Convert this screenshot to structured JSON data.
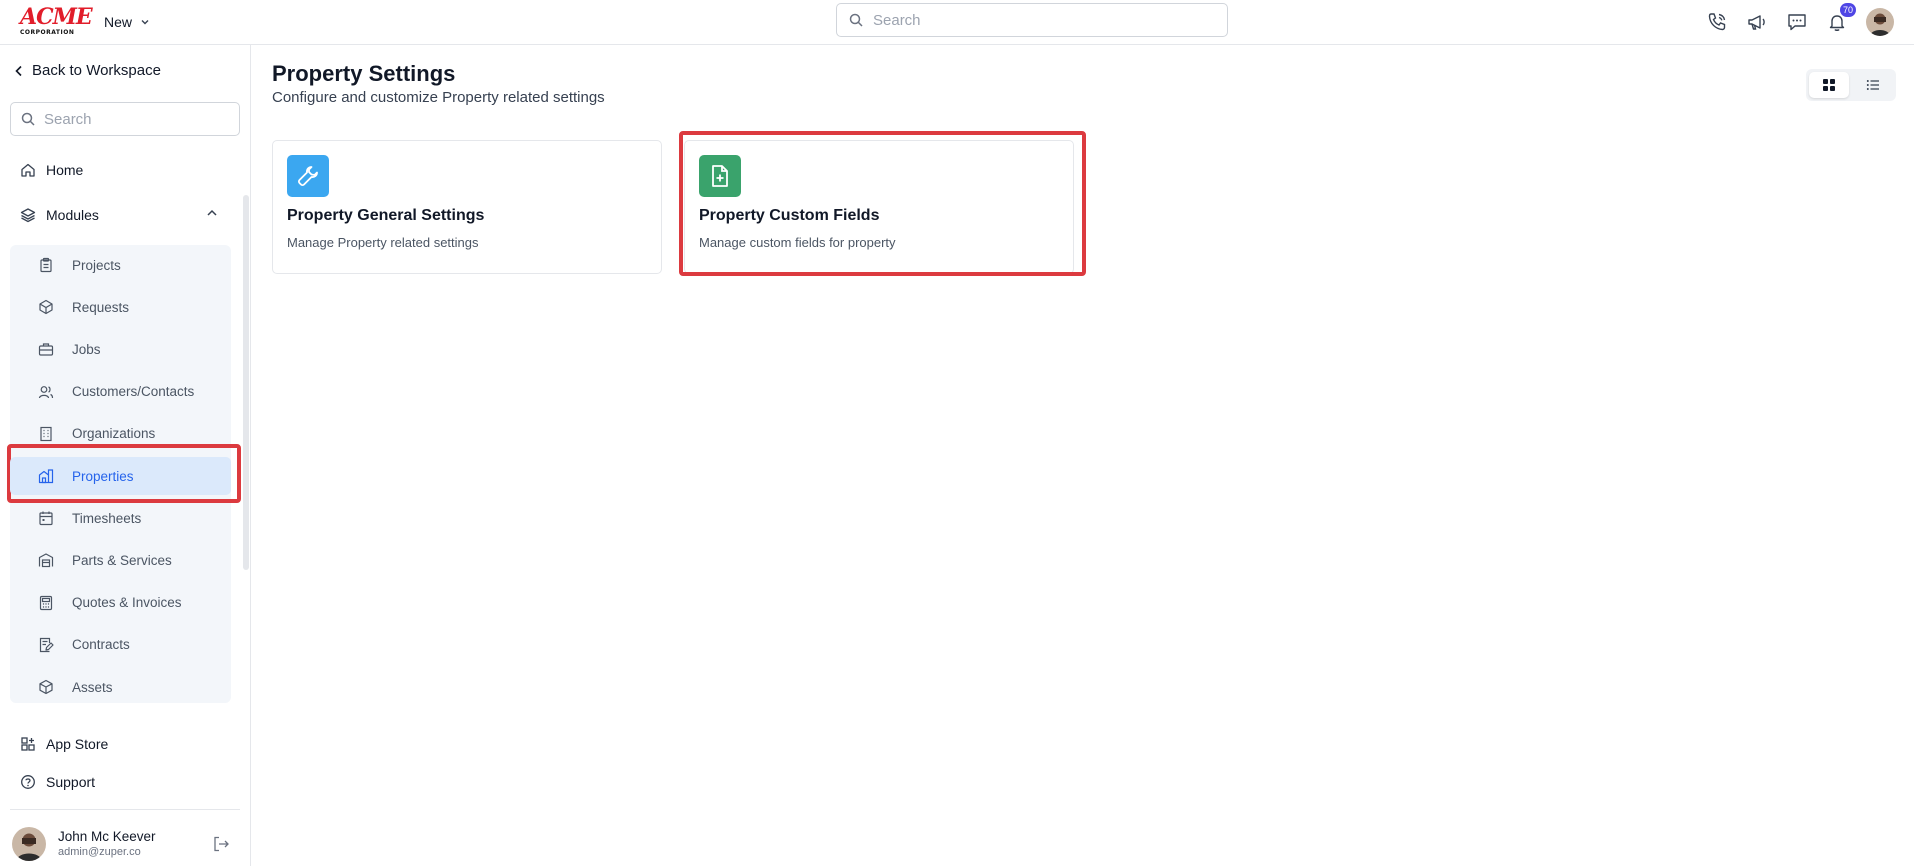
{
  "brand": {
    "logo_main": "ACME",
    "logo_sub": "CORPORATION",
    "accent": "#e11d2a"
  },
  "topbar": {
    "new_label": "New",
    "search_placeholder": "Search",
    "notification_count": "70",
    "icons": [
      "phone-icon",
      "megaphone-icon",
      "chat-icon",
      "bell-icon"
    ]
  },
  "sidebar": {
    "back_label": "Back to Workspace",
    "search_placeholder": "Search",
    "home_label": "Home",
    "modules_label": "Modules",
    "modules": [
      {
        "label": "Projects",
        "icon": "clipboard-icon"
      },
      {
        "label": "Requests",
        "icon": "box-icon"
      },
      {
        "label": "Jobs",
        "icon": "briefcase-icon"
      },
      {
        "label": "Customers/Contacts",
        "icon": "users-icon"
      },
      {
        "label": "Organizations",
        "icon": "building-icon"
      },
      {
        "label": "Properties",
        "icon": "property-icon",
        "active": true
      },
      {
        "label": "Timesheets",
        "icon": "calendar-icon"
      },
      {
        "label": "Parts & Services",
        "icon": "warehouse-icon"
      },
      {
        "label": "Quotes & Invoices",
        "icon": "calculator-icon"
      },
      {
        "label": "Contracts",
        "icon": "contract-icon"
      },
      {
        "label": "Assets",
        "icon": "cube-icon"
      }
    ],
    "app_store_label": "App Store",
    "support_label": "Support",
    "user": {
      "name": "John Mc Keever",
      "email": "admin@zuper.co"
    }
  },
  "main": {
    "title": "Property Settings",
    "subtitle": "Configure and customize Property related settings",
    "cards": [
      {
        "title": "Property General Settings",
        "description": "Manage Property related settings",
        "icon": "wrench-icon",
        "color": "#3ba7f0"
      },
      {
        "title": "Property Custom Fields",
        "description": "Manage custom fields for property",
        "icon": "file-plus-icon",
        "color": "#3aa36c"
      }
    ]
  },
  "colors": {
    "active_bg": "#dbe9fb",
    "active_text": "#2563eb",
    "highlight": "#dc3a3f"
  }
}
